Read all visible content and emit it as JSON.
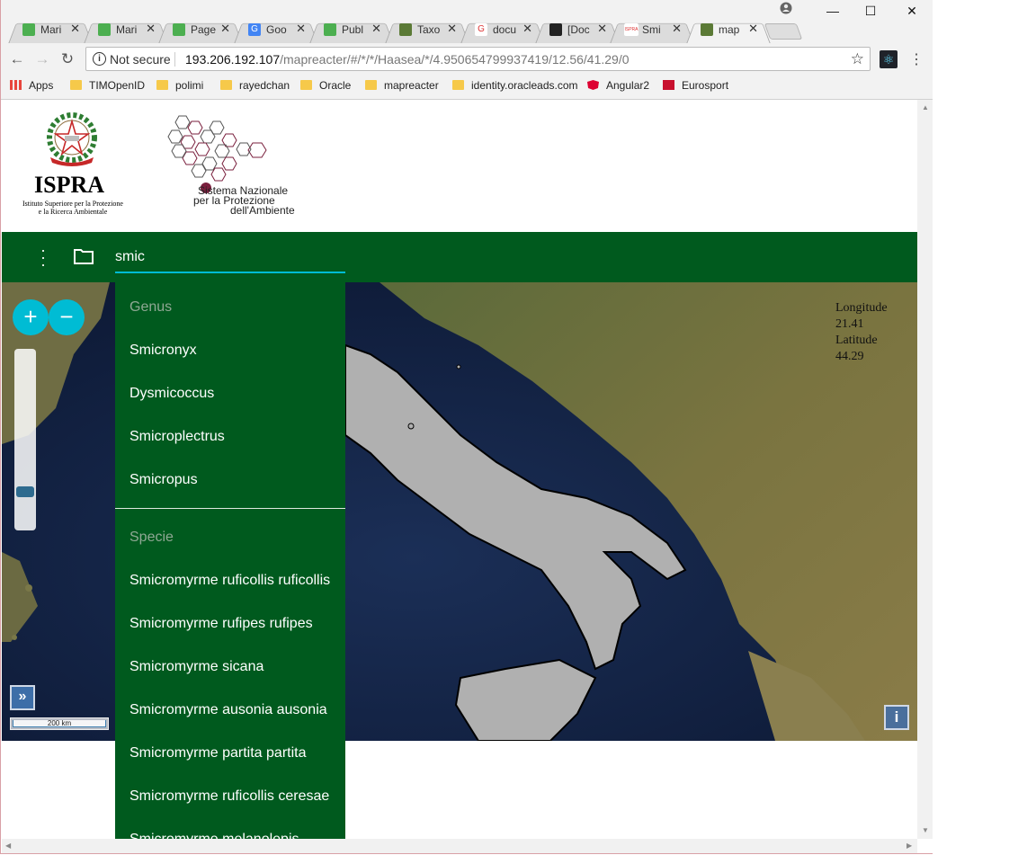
{
  "browser": {
    "tabs": [
      {
        "title": "Mari",
        "fav_color": "#4caf50",
        "fav": "",
        "active": false
      },
      {
        "title": "Mari",
        "fav_color": "#4caf50",
        "fav": "",
        "active": false
      },
      {
        "title": "Page",
        "fav_color": "#4caf50",
        "fav": "",
        "active": false
      },
      {
        "title": "Goo",
        "fav_color": "#4285f4",
        "fav": "G",
        "active": false
      },
      {
        "title": "Publ",
        "fav_color": "#4caf50",
        "fav": "",
        "active": false
      },
      {
        "title": "Taxo",
        "fav_color": "#5b7a36",
        "fav": "",
        "active": false
      },
      {
        "title": "docu",
        "fav_color": "#ffffff",
        "fav": "G",
        "active": false
      },
      {
        "title": "[Doc",
        "fav_color": "#222222",
        "fav": "",
        "active": false
      },
      {
        "title": "Smi",
        "fav_color": "#ffffff",
        "fav": "ISPRA",
        "active": false
      },
      {
        "title": "map",
        "fav_color": "#5b7a36",
        "fav": "",
        "active": true
      }
    ],
    "tab_close": "✕",
    "window_controls": {
      "minimize": "—",
      "maximize": "☐",
      "close": "✕"
    },
    "nav": {
      "back": "←",
      "forward": "→",
      "reload": "↻"
    },
    "address": {
      "security_label": "Not secure",
      "host": "193.206.192.107",
      "path": "/mapreacter/#/*/*/Haasea/*/4.950654799937419/12.56/41.29/0",
      "star": "☆"
    },
    "menu": "⋮",
    "bookmarks": [
      {
        "label": "Apps",
        "icon": "apps-icon"
      },
      {
        "label": "TIMOpenID",
        "icon": "folder-icon"
      },
      {
        "label": "polimi",
        "icon": "folder-icon"
      },
      {
        "label": "rayedchan",
        "icon": "folder-icon"
      },
      {
        "label": "Oracle",
        "icon": "folder-icon"
      },
      {
        "label": "mapreacter",
        "icon": "folder-icon"
      },
      {
        "label": "identity.oracleads.com",
        "icon": "folder-icon"
      },
      {
        "label": "Angular2",
        "icon": "angular-icon"
      },
      {
        "label": "Eurosport",
        "icon": "eurosport-icon"
      }
    ]
  },
  "header": {
    "ispra_title": "ISPRA",
    "ispra_subtitle_line1": "Istituto Superiore per la Protezione",
    "ispra_subtitle_line2": "e la Ricerca Ambientale",
    "snpa_line1": "Sistema Nazionale",
    "snpa_line2": "per la Protezione",
    "snpa_line3": "dell'Ambiente"
  },
  "appbar": {
    "search_value": "smic",
    "accent": "#00bcd4",
    "bar_color": "#005a1e"
  },
  "dropdown": {
    "genus_header": "Genus",
    "genus": [
      "Smicronyx",
      "Dysmicoccus",
      "Smicroplectrus",
      "Smicropus"
    ],
    "specie_header": "Specie",
    "specie": [
      "Smicromyrme ruficollis ruficollis",
      "Smicromyrme rufipes rufipes",
      "Smicromyrme sicana",
      "Smicromyrme ausonia ausonia",
      "Smicromyrme partita partita",
      "Smicromyrme ruficollis ceresae",
      "Smicromyrme melanolepis"
    ]
  },
  "map": {
    "zoom_in": "+",
    "zoom_out": "−",
    "zoom_level_fraction": 0.25,
    "longitude_label": "Longitude",
    "longitude_value": "21.41",
    "latitude_label": "Latitude",
    "latitude_value": "44.29",
    "overview_toggle": "»",
    "scale_label": "200 km",
    "info": "i"
  }
}
